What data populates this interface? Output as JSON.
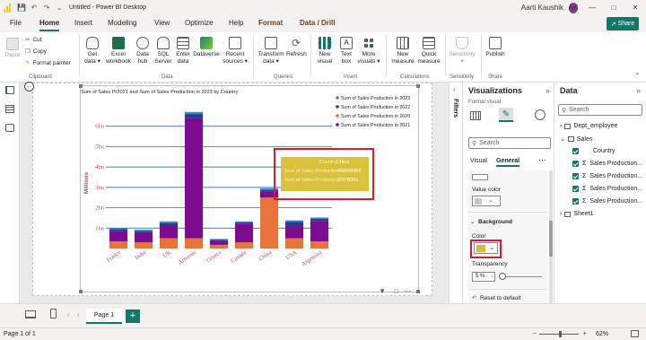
{
  "window": {
    "title": "Untitled - Power BI Desktop",
    "user": "Aarti Kaushik",
    "user_initials": "AK"
  },
  "menu": {
    "tabs": [
      "File",
      "Home",
      "Insert",
      "Modeling",
      "View",
      "Optimize",
      "Help",
      "Format",
      "Data / Drill"
    ],
    "active": "Home",
    "share_label": "Share"
  },
  "ribbon": {
    "paste": "Paste",
    "cut": "Cut",
    "copy": "Copy",
    "format_painter": "Format painter",
    "get_data": "Get data",
    "excel_workbook": "Excel workbook",
    "data_hub": "Data hub",
    "sql_server": "SQL Server",
    "enter_data": "Enter data",
    "dataverse": "Dataverse",
    "recent_sources": "Recent sources",
    "transform_data": "Transform data",
    "refresh": "Refresh",
    "new_visual": "New visual",
    "text_box": "Text box",
    "more_visuals": "More visuals",
    "new_measure": "New measure",
    "quick_measure": "Quick measure",
    "sensitivity": "Sensitivity",
    "publish": "Publish",
    "groups": [
      "Clipboard",
      "Data",
      "Queries",
      "Insert",
      "Calculations",
      "Sensitivity",
      "Share"
    ]
  },
  "canvas": {
    "page_tab": "Page 1",
    "status": "Page 1 of 1",
    "zoom": "62%"
  },
  "chart_data": {
    "type": "bar",
    "stacked": true,
    "title": "Sum of Sales Pr2021 and Sum of Sales Production in 2023 by Country",
    "ylabel": "Millions",
    "xlabel": "",
    "ylim": [
      0,
      7
    ],
    "y_ticks": [
      "1bn",
      "2bn",
      "3bn",
      "4bn",
      "5bn",
      "6bn"
    ],
    "categories": [
      "France",
      "India",
      "UK",
      "Armenia",
      "Greece",
      "Canada",
      "China",
      "USA",
      "Argentina"
    ],
    "series": [
      {
        "name": "Sum of Sales Production in 2023",
        "color": "#3a87c9",
        "values": [
          0.05,
          0.05,
          0.08,
          0.1,
          0.04,
          0.05,
          0.1,
          0.08,
          0.07
        ]
      },
      {
        "name": "Sum of Sales Production in 2022",
        "color": "#1f3f8f",
        "values": [
          0.1,
          0.07,
          0.15,
          0.2,
          0.05,
          0.08,
          0.06,
          0.2,
          0.1
        ]
      },
      {
        "name": "Sum of Sales Production in 2020",
        "color": "#e8743b",
        "values": [
          0.35,
          0.3,
          0.5,
          0.5,
          0.18,
          0.3,
          2.5,
          0.5,
          0.35
        ]
      },
      {
        "name": "Sum of Sales Production in 2021",
        "color": "#7b0b8f",
        "values": [
          0.5,
          0.5,
          0.6,
          5.9,
          0.2,
          0.9,
          0.3,
          0.6,
          1.0
        ]
      }
    ],
    "legend_position": "top-right",
    "grid": true,
    "tooltip": {
      "rows": [
        {
          "label": "Country",
          "value": "China"
        },
        {
          "label": "Sum of Sales Production in 2020",
          "value": "448666069"
        },
        {
          "label": "Sum of Sales Production in 2021",
          "value": "32378301"
        }
      ]
    }
  },
  "viz_pane": {
    "title": "Visualizations",
    "format_visual": "Format visual",
    "search_placeholder": "Search",
    "tab_visual": "Visual",
    "tab_general": "General",
    "value_color": "Value color",
    "background": "Background",
    "color": "Color",
    "color_swatch": "#d9b93a",
    "transparency": "Transparency",
    "transparency_value": "5",
    "transparency_unit": "%",
    "transparency_level": 0.05,
    "reset": "Reset to default"
  },
  "filters": {
    "label": "Filters"
  },
  "data_pane": {
    "title": "Data",
    "search_placeholder": "Search",
    "tables": [
      {
        "name": "Dept_employee",
        "expanded": false
      },
      {
        "name": "Sales",
        "expanded": true,
        "fields": [
          "Country",
          "Sales Production...",
          "Sales Production...",
          "Sales Production...",
          "Sales Production..."
        ]
      },
      {
        "name": "Sheet1",
        "expanded": false
      }
    ]
  }
}
